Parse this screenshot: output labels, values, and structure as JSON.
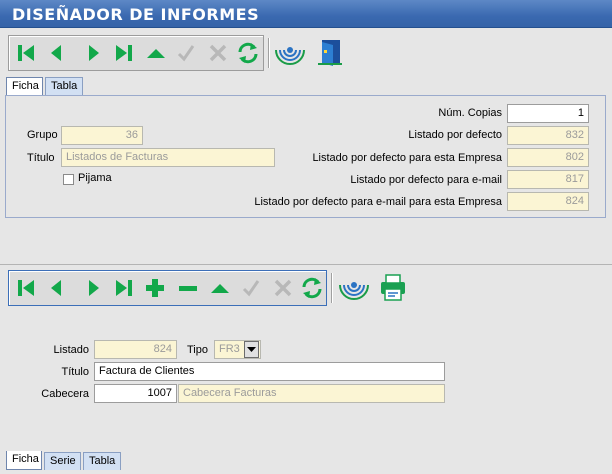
{
  "window": {
    "title": "DISEÑADOR DE INFORMES"
  },
  "colors": {
    "green": "#12a84a",
    "blue": "#2b73c3",
    "disabled": "#b8b8b8",
    "title_bg": "#3a69b0",
    "field_bg": "#fbf5d4"
  },
  "top_toolbar": {
    "buttons": [
      "first-record-icon",
      "previous-record-icon",
      "next-record-icon",
      "last-record-icon",
      "move-up-icon",
      "confirm-check-icon",
      "cancel-x-icon",
      "refresh-icon"
    ],
    "extra": [
      "wireless-signal-icon",
      "exit-door-icon"
    ]
  },
  "top_tabs": {
    "ficha": "Ficha",
    "tabla": "Tabla"
  },
  "top_form": {
    "grupo_label": "Grupo",
    "grupo_value": "36",
    "titulo_label": "Título",
    "titulo_placeholder": "Listados de Facturas",
    "pijama_label": "Pijama",
    "num_copias_label": "Núm. Copias",
    "num_copias_value": "1",
    "listado_defecto_label": "Listado por defecto",
    "listado_defecto_value": "832",
    "listado_empresa_label": "Listado por defecto para esta Empresa",
    "listado_empresa_value": "802",
    "listado_email_label": "Listado por defecto para e-mail",
    "listado_email_value": "817",
    "listado_email_empresa_label": "Listado por defecto para e-mail para esta Empresa",
    "listado_email_empresa_value": "824"
  },
  "bottom_toolbar": {
    "buttons": [
      "first-record-icon",
      "previous-record-icon",
      "next-record-icon",
      "last-record-icon",
      "add-record-icon",
      "remove-record-icon",
      "move-up-icon",
      "confirm-check-icon",
      "cancel-x-icon",
      "refresh-icon"
    ],
    "extra": [
      "wireless-signal-icon",
      "print-icon"
    ]
  },
  "bottom_form": {
    "listado_label": "Listado",
    "listado_value": "824",
    "tipo_label": "Tipo",
    "tipo_value": "FR3",
    "titulo_label": "Título",
    "titulo_value": "Factura de Clientes",
    "cabecera_label": "Cabecera",
    "cabecera_value": "1007",
    "cabecera_desc": "Cabecera Facturas"
  },
  "bottom_tabs": {
    "ficha": "Ficha",
    "serie": "Serie",
    "tabla": "Tabla"
  }
}
